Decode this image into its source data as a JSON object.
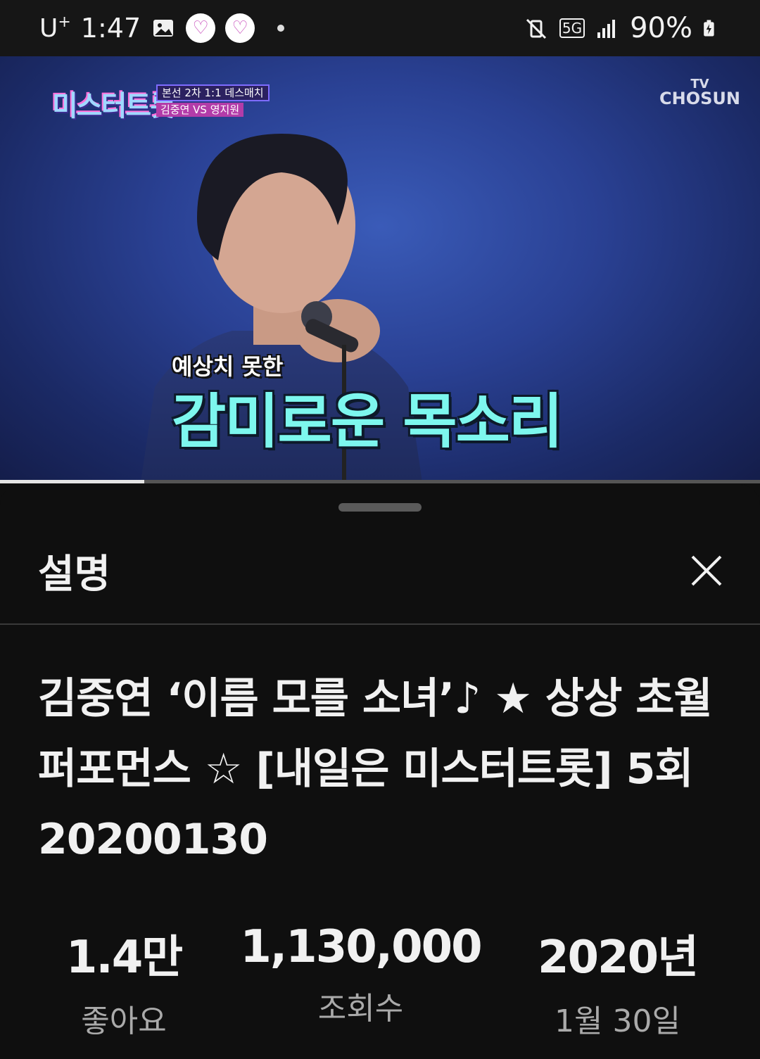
{
  "status_bar": {
    "carrier": "U",
    "carrier_sup": "+",
    "time": "1:47",
    "network": "5G",
    "battery": "90%"
  },
  "video": {
    "show_logo": "미스터트롯",
    "match_line1": "본선 2차 1:1 데스매치",
    "match_line2": "김중연 VS 영지원",
    "broadcaster_line1": "TV",
    "broadcaster_line2": "CHOSUN",
    "caption_small": "예상치 못한",
    "caption_big": "감미로운 목소리",
    "progress": 0.19
  },
  "sheet": {
    "title": "설명",
    "video_title": "김중연 ‘이름 모를 소녀’♪ ★ 상상 초월 퍼포먼스 ☆ [내일은 미스터트롯] 5회 20200130",
    "stats": [
      {
        "value": "1.4만",
        "label": "좋아요"
      },
      {
        "value": "1,130,000",
        "label": "조회수"
      },
      {
        "value": "2020년",
        "label": "1월 30일"
      }
    ]
  },
  "icons": {
    "close": "close-icon",
    "gallery": "gallery-icon",
    "mute": "vibrate-off-icon",
    "signal": "signal-icon",
    "battery": "battery-charging-icon"
  }
}
